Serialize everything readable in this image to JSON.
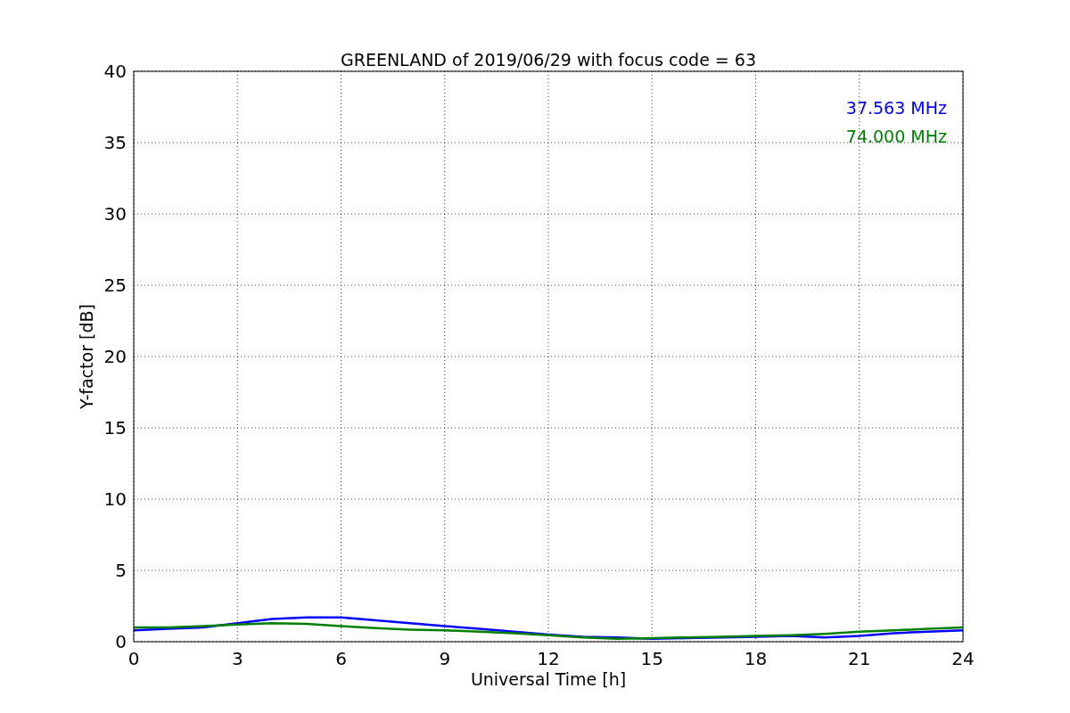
{
  "chart_data": {
    "type": "line",
    "title": "GREENLAND of 2019/06/29 with focus code = 63",
    "xlabel": "Universal Time [h]",
    "ylabel": "Y-factor [dB]",
    "x": [
      0,
      1,
      2,
      3,
      4,
      5,
      6,
      7,
      8,
      9,
      10,
      11,
      12,
      13,
      14,
      15,
      16,
      17,
      18,
      19,
      20,
      21,
      22,
      23,
      24
    ],
    "series": [
      {
        "name": "37.563 MHz",
        "color": "#0000ff",
        "values": [
          0.8,
          0.9,
          1.0,
          1.3,
          1.6,
          1.7,
          1.7,
          1.5,
          1.3,
          1.1,
          0.9,
          0.7,
          0.5,
          0.35,
          0.3,
          0.2,
          0.25,
          0.3,
          0.35,
          0.4,
          0.3,
          0.4,
          0.6,
          0.7,
          0.8
        ]
      },
      {
        "name": "74.000 MHz",
        "color": "#008000",
        "values": [
          1.0,
          1.0,
          1.1,
          1.2,
          1.3,
          1.25,
          1.1,
          0.95,
          0.85,
          0.8,
          0.7,
          0.6,
          0.45,
          0.3,
          0.2,
          0.25,
          0.3,
          0.35,
          0.4,
          0.45,
          0.55,
          0.7,
          0.8,
          0.9,
          1.0
        ]
      }
    ],
    "xlim": [
      0,
      24
    ],
    "ylim": [
      0,
      40
    ],
    "xticks": [
      0,
      3,
      6,
      9,
      12,
      15,
      18,
      21,
      24
    ],
    "yticks": [
      0,
      5,
      10,
      15,
      20,
      25,
      30,
      35,
      40
    ],
    "grid": true
  }
}
